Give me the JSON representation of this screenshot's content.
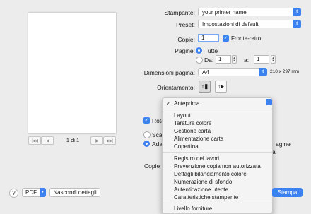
{
  "preview": {
    "page_label": "1 di 1",
    "first_icon": "first-page-icon",
    "prev_icon": "prev-page-icon",
    "next_icon": "next-page-icon",
    "last_icon": "last-page-icon"
  },
  "printer": {
    "label": "Stampante:",
    "value": "your printer name"
  },
  "presets": {
    "label": "Preset:",
    "value": "Impostazioni di default"
  },
  "copies": {
    "label": "Copie:",
    "value": "1",
    "duplex_label": "Fronte-retro",
    "duplex_checked": true
  },
  "pages": {
    "label": "Pagine:",
    "all_label": "Tutte",
    "from_label": "Da:",
    "from_value": "1",
    "to_label": "a:",
    "to_value": "1"
  },
  "paper_size": {
    "label": "Dimensioni pagina:",
    "value": "A4",
    "dims": "210 x 297 mm"
  },
  "orientation": {
    "label": "Orientamento:",
    "portrait_icon": "portrait-orientation-icon",
    "landscape_icon": "landscape-orientation-icon"
  },
  "background": {
    "rotate_partial": "Rotaz",
    "scale_partial": "Scala",
    "fit_partial": "Adatt",
    "copies_partial": "Copie pe",
    "pages_partial": "agine",
    "to_partial": "a"
  },
  "menu": {
    "checked_item": "Anteprima",
    "group1": [
      "Layout",
      "Taratura colore",
      "Gestione carta",
      "Alimentazione carta",
      "Copertina"
    ],
    "group2": [
      "Registro dei lavori",
      "Prevenzione copia non autorizzata",
      "Dettagli bilanciamento colore",
      "Numerazione di sfondo",
      "Autenticazione utente",
      "Caratteristiche stampante"
    ],
    "group3": [
      "Livello forniture"
    ]
  },
  "footer": {
    "help_label": "?",
    "pdf_label": "PDF",
    "hide_details_label": "Nascondi dettagli",
    "print_label": "Stampa"
  },
  "colors": {
    "accent": "#3b82f0",
    "window_bg": "#ececec"
  }
}
